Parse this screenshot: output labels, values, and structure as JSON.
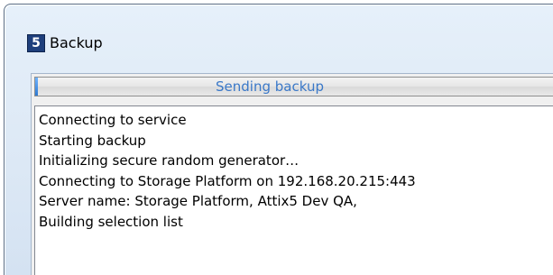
{
  "window": {
    "title": "Backup",
    "icon_name": "app-5-icon",
    "icon_glyph": "5"
  },
  "progress": {
    "label": "Sending backup",
    "fraction": 0.005
  },
  "log": {
    "lines": [
      "Connecting to service",
      "Starting backup",
      "Initializing secure random generator…",
      "Connecting to Storage Platform on 192.168.20.215:443",
      "Server name: Storage Platform, Attix5 Dev QA,",
      "Building selection list"
    ]
  },
  "colors": {
    "progress_text": "#3a78c8",
    "title_bar": "#dce8f5"
  }
}
